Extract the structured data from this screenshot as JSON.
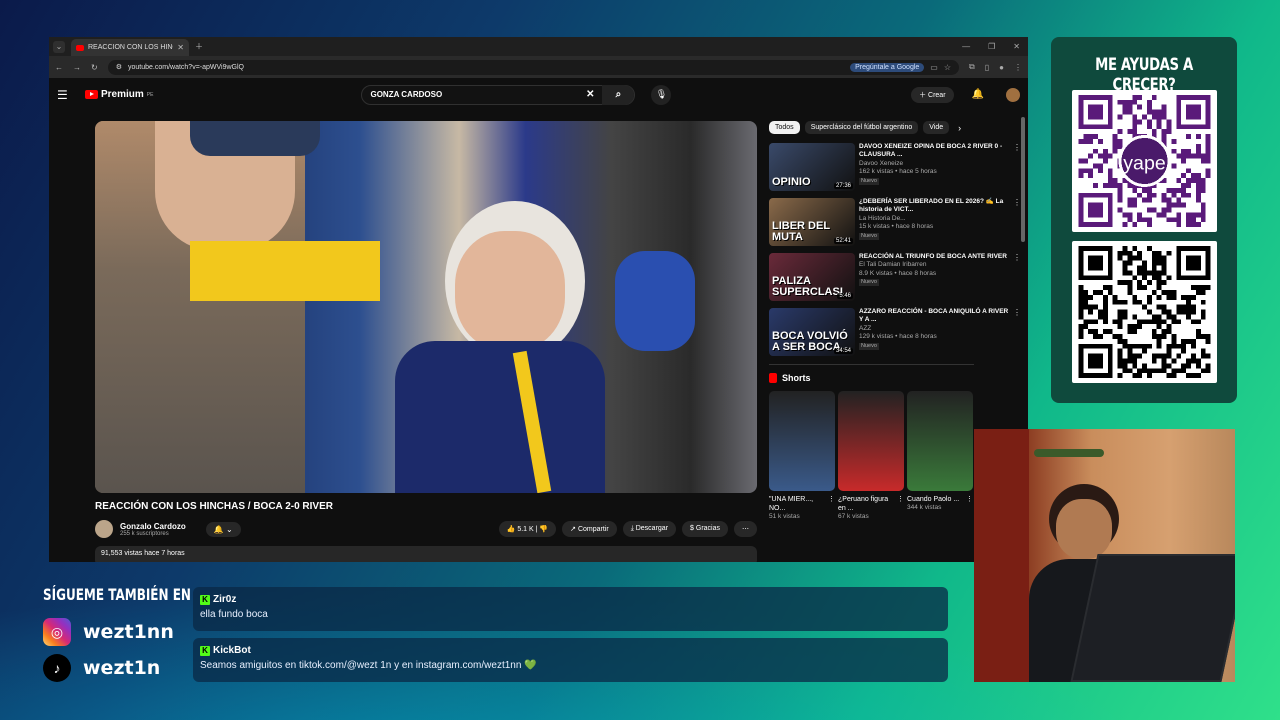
{
  "browser": {
    "tab_title": "REACCIÓN CON LOS HINCHAS",
    "url": "youtube.com/watch?v=-apWVi9wGlQ",
    "google_pill": "Pregúntale a Google"
  },
  "youtube": {
    "logo_text": "Premium",
    "logo_region": "PE",
    "search_value": "GONZA CARDOSO",
    "create_label": "Crear",
    "video": {
      "title": "REACCIÓN CON LOS HINCHAS / BOCA 2-0 RIVER",
      "channel": "Gonzalo Cardozo",
      "subscribers": "255 k suscriptores",
      "likes": "5.1 K",
      "share": "Compartir",
      "download": "Descargar",
      "thanks": "Gracias",
      "views_date": "91,553 vistas  hace 7 horas"
    },
    "chips": [
      "Todos",
      "Superclásico del fútbol argentino",
      "Vide"
    ],
    "recommendations": [
      {
        "title": "DAVOO XENEIZE OPINA DE BOCA 2 RIVER 0 - CLAUSURA ...",
        "channel": "Davoo Xeneize",
        "meta": "162 k vistas • hace 5 horas",
        "badge": "Nuevo",
        "duration": "27:36",
        "caption": "OPINIO",
        "color": "#3a4a6a"
      },
      {
        "title": "¿DEBERÍA SER LIBERADO EN EL 2026? ✍️ La historia de VICT...",
        "channel": "La Historia De...",
        "meta": "15 k vistas • hace 8 horas",
        "badge": "Nuevo",
        "duration": "52:41",
        "caption": "LIBER DEL MUTA",
        "color": "#8a6a4a"
      },
      {
        "title": "REACCIÓN AL TRIUNFO DE BOCA ANTE RIVER",
        "channel": "El Tali Damian Iribarren",
        "meta": "8.9 K vistas • hace 8 horas",
        "badge": "Nuevo",
        "duration": "5:46",
        "caption": "PALIZA SUPERCLASI",
        "color": "#6a2a3a"
      },
      {
        "title": "AZZARO REACCIÓN - BOCA ANIQUILÓ A RIVER Y A ...",
        "channel": "AZZ",
        "meta": "129 k vistas • hace 8 horas",
        "badge": "Nuevo",
        "duration": "34:54",
        "caption": "BOCA VOLVIÓ A SER BOCA",
        "color": "#2a3a6a"
      }
    ],
    "shorts_label": "Shorts",
    "shorts": [
      {
        "title": "\"UNA MIER..., NO...",
        "views": "51 k vistas",
        "color": "#3a5a8a"
      },
      {
        "title": "¿Peruano figura en ...",
        "views": "67 k vistas",
        "color": "#c82a2a"
      },
      {
        "title": "Cuando Paolo ...",
        "views": "344 k vistas",
        "color": "#3a7a3a"
      }
    ]
  },
  "overlay": {
    "qr_title": "ME AYUDAS A CRECER?",
    "qr_brand": "yape",
    "follow_title": "SÍGUEME TAMBIÉN EN",
    "instagram_handle": "wezt1nn",
    "tiktok_handle": "wezt1n",
    "chat": [
      {
        "user": "Zir0z",
        "text": "ella fundo boca"
      },
      {
        "user": "KickBot",
        "text": "Seamos amiguitos en tiktok.com/@wezt 1n y en instagram.com/wezt1nn 💚"
      }
    ]
  }
}
